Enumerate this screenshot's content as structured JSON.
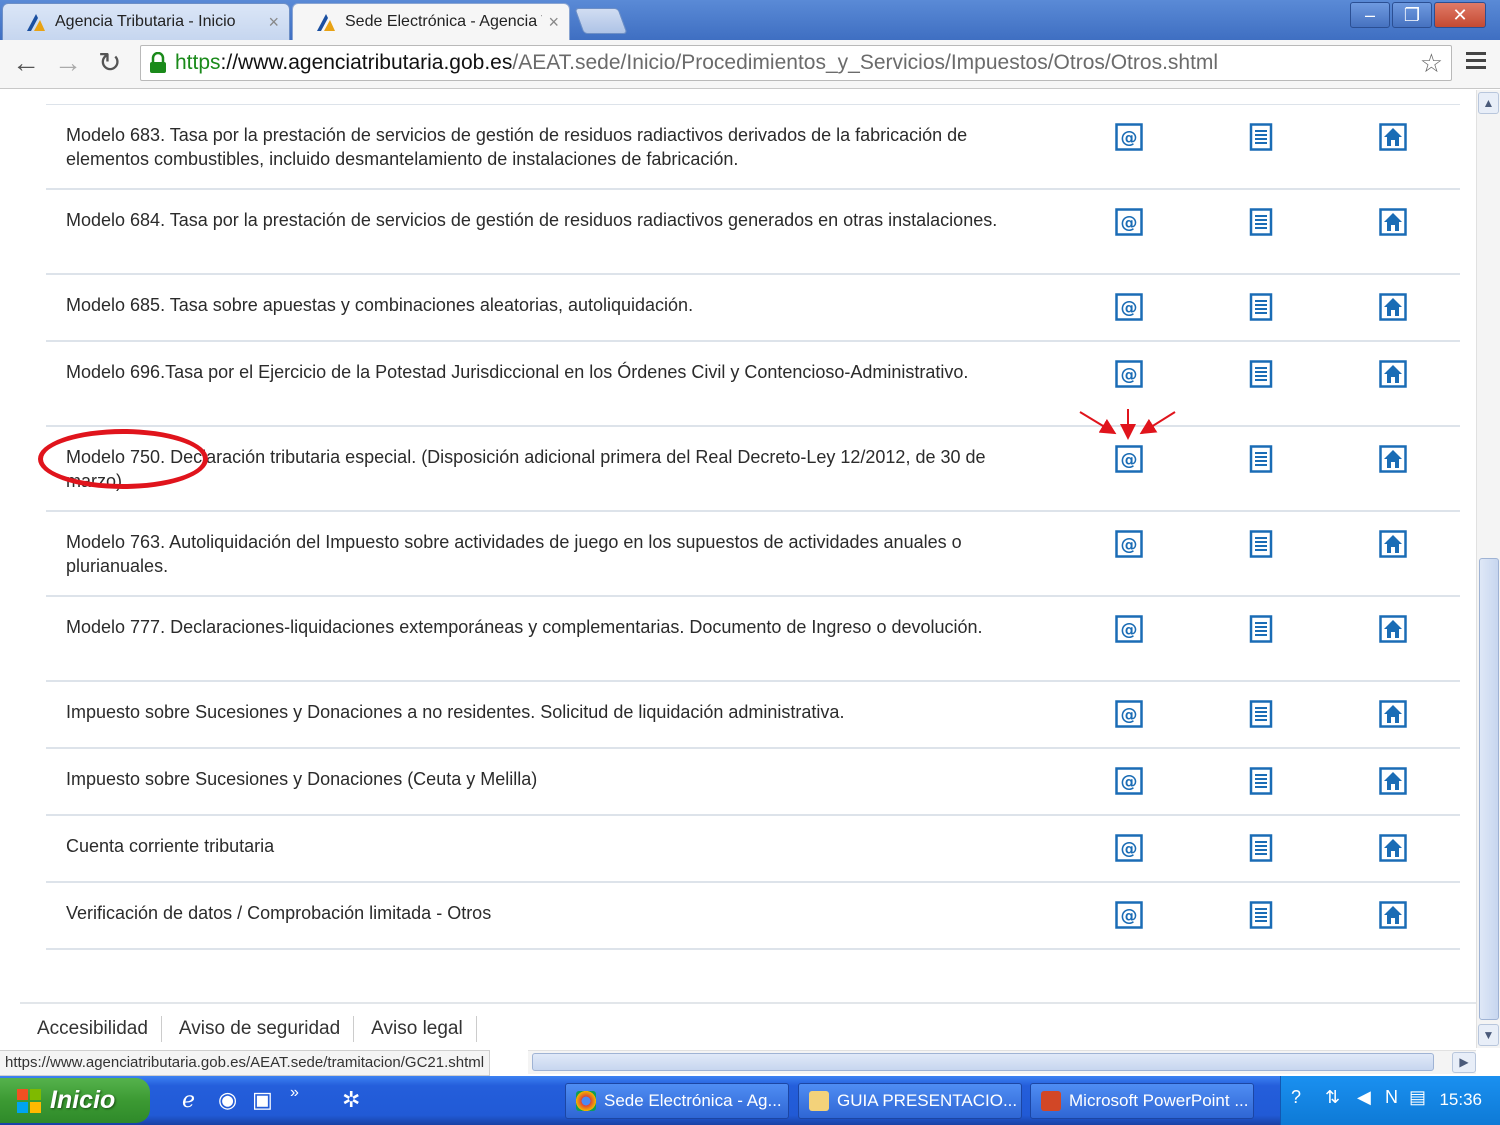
{
  "browser": {
    "tabs": [
      {
        "title": "Agencia Tributaria - Inicio",
        "active": false
      },
      {
        "title": "Sede Electrónica - Agencia Tri",
        "active": true
      }
    ],
    "url": {
      "scheme": "https",
      "host": "://www.agenciatributaria.gob.es",
      "path": "/AEAT.sede/Inicio/Procedimientos_y_Servicios/Impuestos/Otros/Otros.shtml"
    },
    "status_url": "https://www.agenciatributaria.gob.es/AEAT.sede/tramitacion/GC21.shtml"
  },
  "procedures": [
    {
      "text": "Modelo 683. Tasa por la prestación de servicios de gestión de residuos radiactivos derivados de la fabricación de elementos combustibles, incluido desmantelamiento de instalaciones de fabricación."
    },
    {
      "text": "Modelo 684. Tasa por la prestación de servicios de gestión de residuos radiactivos generados en otras instalaciones."
    },
    {
      "text": "Modelo 685. Tasa sobre apuestas y combinaciones aleatorias, autoliquidación."
    },
    {
      "text": "Modelo 696.Tasa por el Ejercicio de la Potestad Jurisdiccional en los Órdenes Civil y Contencioso-Administrativo."
    },
    {
      "text": "Modelo 750. Declaración tributaria especial. (Disposición adicional primera del Real Decreto-Ley 12/2012, de 30 de marzo)"
    },
    {
      "text": "Modelo 763. Autoliquidación del Impuesto sobre actividades de juego en los supuestos de actividades anuales o plurianuales."
    },
    {
      "text": "Modelo 777. Declaraciones-liquidaciones extemporáneas y complementarias. Documento de Ingreso o devolución."
    },
    {
      "text": "Impuesto sobre Sucesiones y Donaciones a no residentes. Solicitud de liquidación administrativa."
    },
    {
      "text": "Impuesto sobre Sucesiones y Donaciones (Ceuta y Melilla)"
    },
    {
      "text": "Cuenta corriente tributaria"
    },
    {
      "text": "Verificación de datos / Comprobación limitada - Otros"
    }
  ],
  "footer_links": [
    "Accesibilidad",
    "Aviso de seguridad",
    "Aviso legal"
  ],
  "taskbar": {
    "start_label": "Inicio",
    "tasks": [
      {
        "label": "Sede Electrónica - Ag..."
      },
      {
        "label": "GUIA PRESENTACIO..."
      },
      {
        "label": "Microsoft PowerPoint ..."
      }
    ],
    "clock": "15:36"
  },
  "colors": {
    "icon_blue": "#1a6cb5",
    "annotation_red": "#e0141c",
    "url_green": "#1a8a1a"
  },
  "icons": {
    "row_actions": [
      "at-sign-icon",
      "document-icon",
      "home-icon"
    ]
  }
}
